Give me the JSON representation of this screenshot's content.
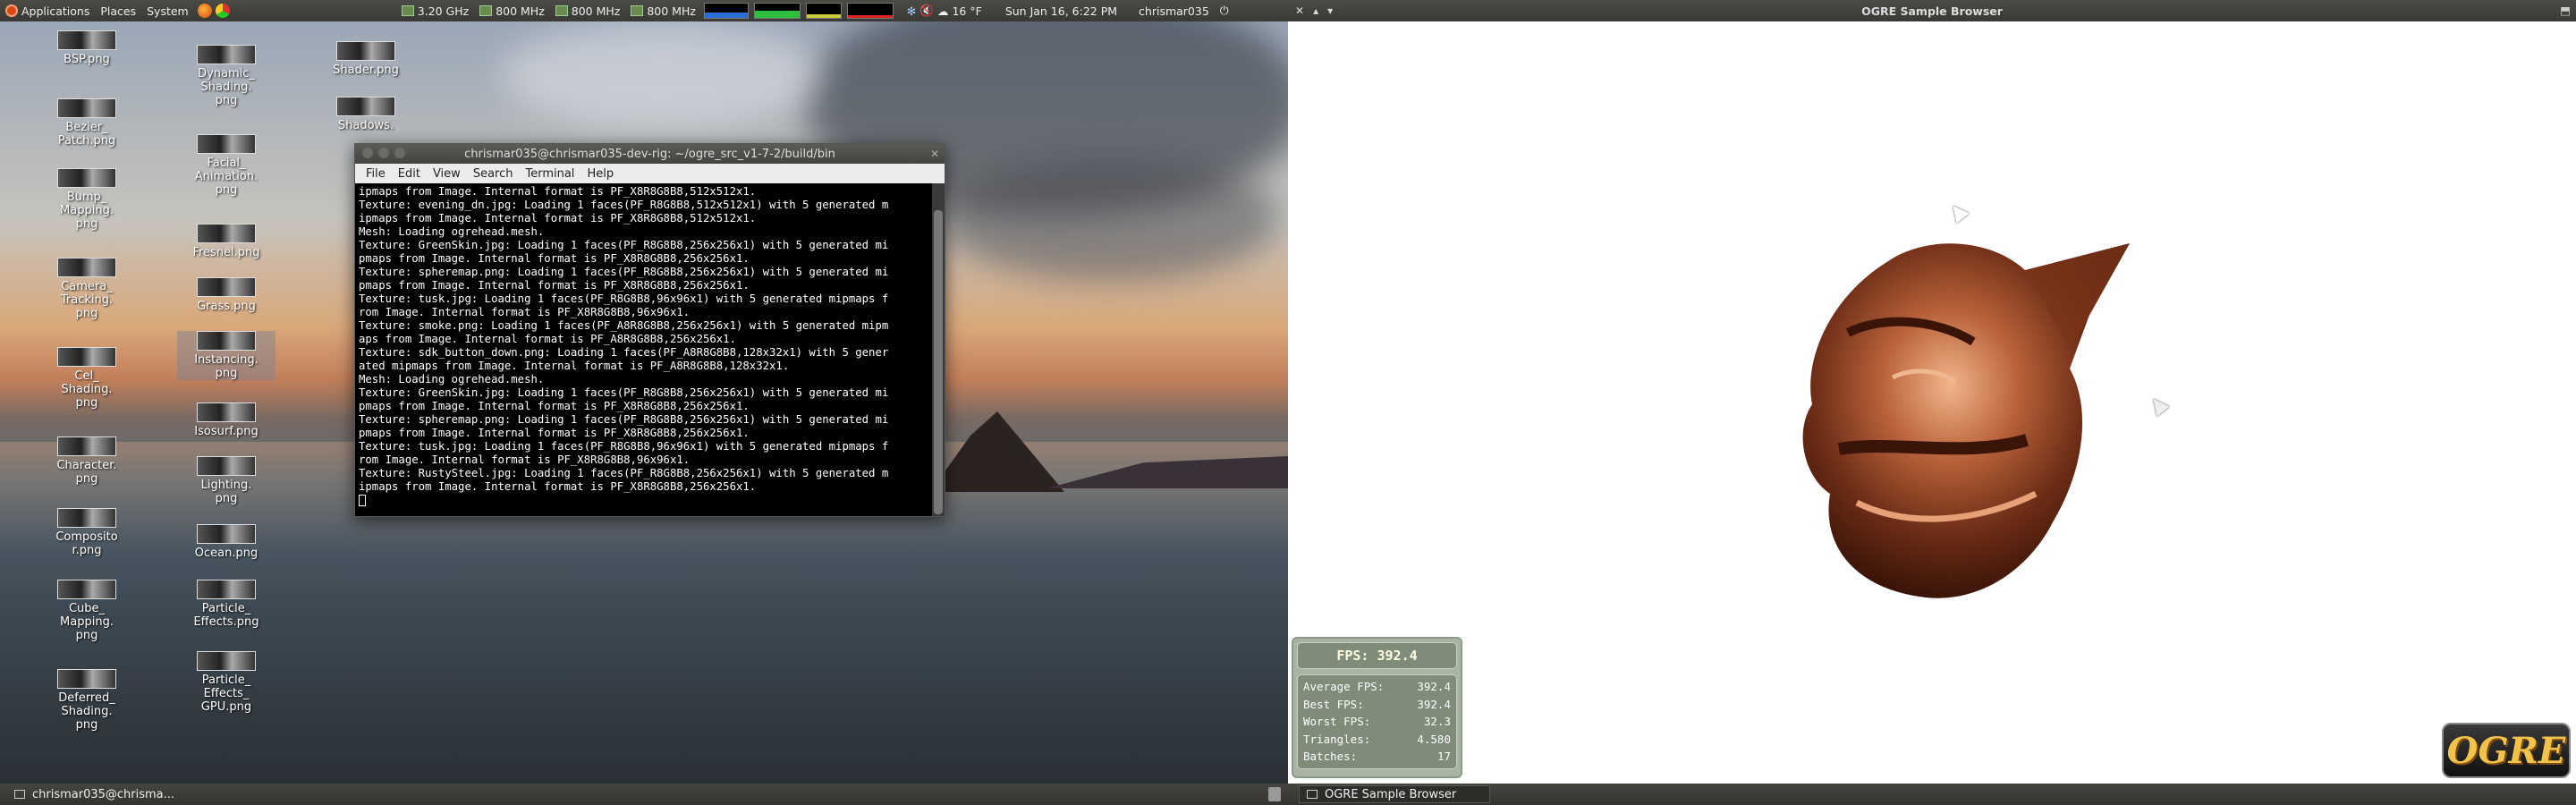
{
  "top_panel": {
    "menus": [
      "Applications",
      "Places",
      "System"
    ],
    "cpu_freqs": [
      "3.20 GHz",
      "800 MHz",
      "800 MHz",
      "800 MHz"
    ],
    "weather": "16 °F",
    "datetime": "Sun Jan 16,  6:22 PM",
    "user": "chrismar035",
    "window_title": "OGRE Sample Browser"
  },
  "desktop_icons": [
    {
      "label": "BSP.png"
    },
    {
      "label": "Bezier_\nPatch.png"
    },
    {
      "label": "Bump_\nMapping.\npng"
    },
    {
      "label": "Camera_\nTracking.\npng"
    },
    {
      "label": "Cel_\nShading.\npng"
    },
    {
      "label": "Character.\npng"
    },
    {
      "label": "Composito\nr.png"
    },
    {
      "label": "Cube_\nMapping.\npng"
    },
    {
      "label": "Deferred_\nShading.\npng"
    },
    {
      "label": "Dynamic_\nShading.\npng"
    },
    {
      "label": "Facial_\nAnimation.\npng"
    },
    {
      "label": "Fresnel.png"
    },
    {
      "label": "Grass.png"
    },
    {
      "label": "Instancing.\npng"
    },
    {
      "label": "Isosurf.png"
    },
    {
      "label": "Lighting.\npng"
    },
    {
      "label": "Ocean.png"
    },
    {
      "label": "Particle_\nEffects.png"
    },
    {
      "label": "Particle_\nEffects_\nGPU.png"
    },
    {
      "label": "Shader.png"
    },
    {
      "label": "Shadows."
    }
  ],
  "terminal": {
    "title": "chrismar035@chrismar035-dev-rig: ~/ogre_src_v1-7-2/build/bin",
    "menu": [
      "File",
      "Edit",
      "View",
      "Search",
      "Terminal",
      "Help"
    ],
    "lines": [
      "ipmaps from Image. Internal format is PF_X8R8G8B8,512x512x1.",
      "Texture: evening_dn.jpg: Loading 1 faces(PF_R8G8B8,512x512x1) with 5 generated m",
      "ipmaps from Image. Internal format is PF_X8R8G8B8,512x512x1.",
      "Mesh: Loading ogrehead.mesh.",
      "Texture: GreenSkin.jpg: Loading 1 faces(PF_R8G8B8,256x256x1) with 5 generated mi",
      "pmaps from Image. Internal format is PF_X8R8G8B8,256x256x1.",
      "Texture: spheremap.png: Loading 1 faces(PF_R8G8B8,256x256x1) with 5 generated mi",
      "pmaps from Image. Internal format is PF_X8R8G8B8,256x256x1.",
      "Texture: tusk.jpg: Loading 1 faces(PF_R8G8B8,96x96x1) with 5 generated mipmaps f",
      "rom Image. Internal format is PF_X8R8G8B8,96x96x1.",
      "Texture: smoke.png: Loading 1 faces(PF_A8R8G8B8,256x256x1) with 5 generated mipm",
      "aps from Image. Internal format is PF_A8R8G8B8,256x256x1.",
      "Texture: sdk_button_down.png: Loading 1 faces(PF_A8R8G8B8,128x32x1) with 5 gener",
      "ated mipmaps from Image. Internal format is PF_A8R8G8B8,128x32x1.",
      "Mesh: Loading ogrehead.mesh.",
      "Texture: GreenSkin.jpg: Loading 1 faces(PF_R8G8B8,256x256x1) with 5 generated mi",
      "pmaps from Image. Internal format is PF_X8R8G8B8,256x256x1.",
      "Texture: spheremap.png: Loading 1 faces(PF_R8G8B8,256x256x1) with 5 generated mi",
      "pmaps from Image. Internal format is PF_X8R8G8B8,256x256x1.",
      "Texture: tusk.jpg: Loading 1 faces(PF_R8G8B8,96x96x1) with 5 generated mipmaps f",
      "rom Image. Internal format is PF_X8R8G8B8,96x96x1.",
      "Texture: RustySteel.jpg: Loading 1 faces(PF_R8G8B8,256x256x1) with 5 generated m",
      "ipmaps from Image. Internal format is PF_X8R8G8B8,256x256x1."
    ]
  },
  "fps_panel": {
    "fps": "FPS: 392.4",
    "rows": [
      {
        "label": "Average FPS:",
        "value": "392.4"
      },
      {
        "label": "Best FPS:",
        "value": "392.4"
      },
      {
        "label": "Worst FPS:",
        "value": "32.3"
      },
      {
        "label": "Triangles:",
        "value": "4.580"
      },
      {
        "label": "Batches:",
        "value": "17"
      }
    ]
  },
  "ogre_logo": "OGRE",
  "taskbar": {
    "items": [
      "chrismar035@chrisma...",
      "OGRE Sample Browser"
    ]
  },
  "colors": {
    "panel": "#3f3e3a",
    "accent_orange": "#dd4814",
    "fps_panel": "#7e8c79",
    "bronze": "#a0532c"
  }
}
